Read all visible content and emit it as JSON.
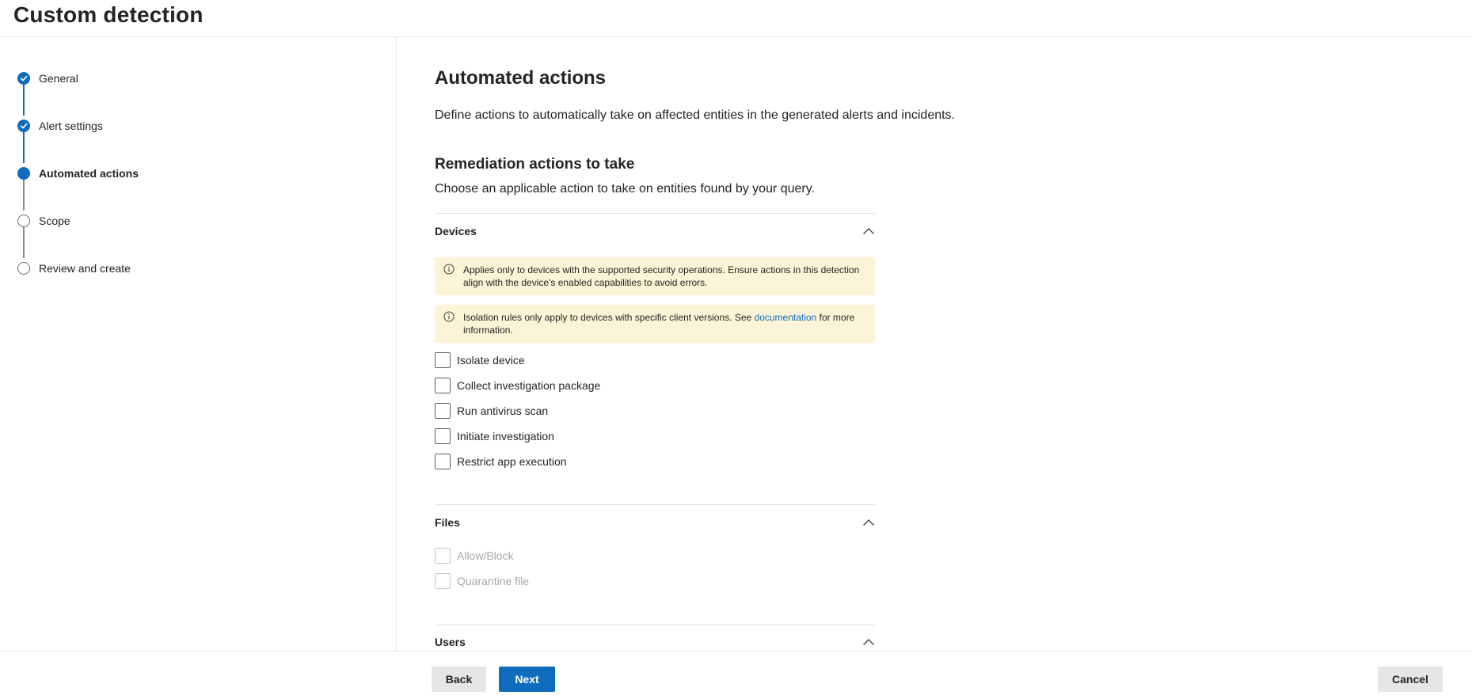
{
  "page": {
    "title": "Custom detection"
  },
  "wizard": {
    "steps": [
      {
        "label": "General",
        "state": "completed"
      },
      {
        "label": "Alert settings",
        "state": "completed"
      },
      {
        "label": "Automated actions",
        "state": "current"
      },
      {
        "label": "Scope",
        "state": "pending"
      },
      {
        "label": "Review and create",
        "state": "pending"
      }
    ]
  },
  "main": {
    "title": "Automated actions",
    "description": "Define actions to automatically take on affected entities in the generated alerts and incidents.",
    "remediation": {
      "title": "Remediation actions to take",
      "description": "Choose an applicable action to take on entities found by your query."
    },
    "devices": {
      "label": "Devices",
      "banner1": "Applies only to devices with the supported security operations. Ensure actions in this detection align with the device's enabled capabilities to avoid errors.",
      "banner2_prefix": "Isolation rules only apply to devices with specific client versions. See ",
      "banner2_link": "documentation",
      "banner2_suffix": " for more information.",
      "actions": [
        "Isolate device",
        "Collect investigation package",
        "Run antivirus scan",
        "Initiate investigation",
        "Restrict app execution"
      ]
    },
    "files": {
      "label": "Files",
      "actions": [
        "Allow/Block",
        "Quarantine file"
      ]
    },
    "users": {
      "label": "Users"
    }
  },
  "footer": {
    "back": "Back",
    "next": "Next",
    "cancel": "Cancel"
  },
  "colors": {
    "accent": "#0f6cbd",
    "warning_bg": "#fcf4d6"
  }
}
